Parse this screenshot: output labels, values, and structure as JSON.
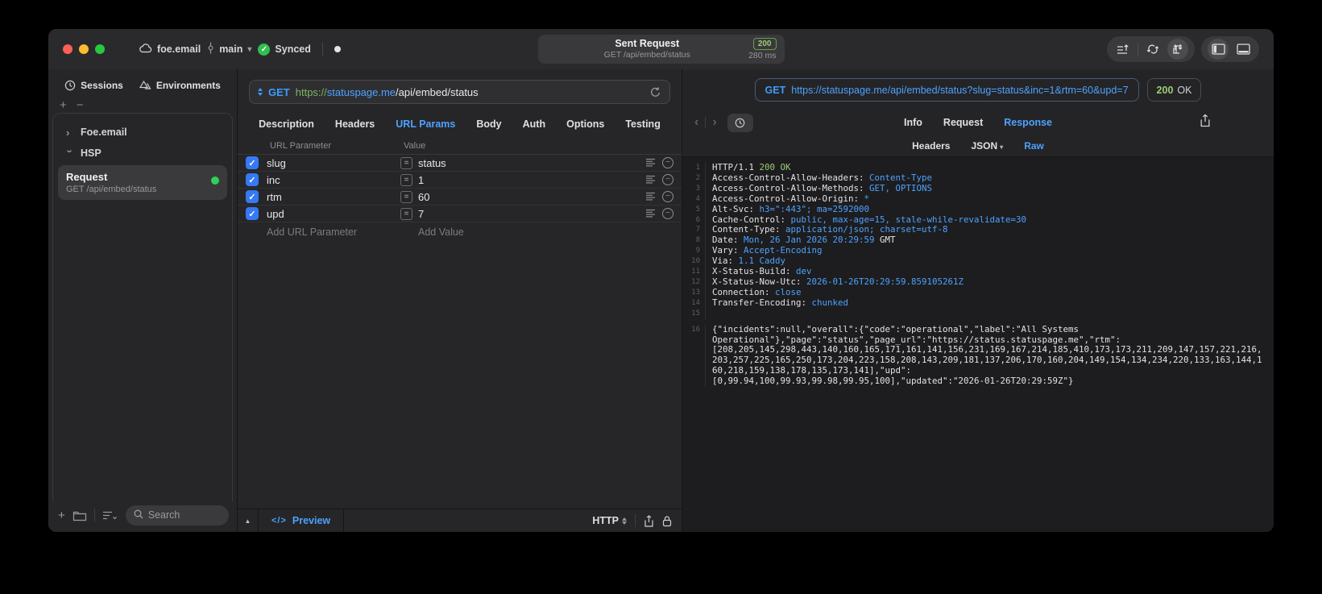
{
  "colors": {
    "accent_blue": "#4da2ff",
    "method_blue": "#3e9bff",
    "status_green": "#9bcc72",
    "scheme_green": "#79b65f",
    "checkbox_blue": "#3579f6",
    "green_dot": "#30d158",
    "traffic_red": "#ff5f57",
    "traffic_yellow": "#febc2e",
    "traffic_green": "#28c840"
  },
  "titlebar": {
    "project": "foe.email",
    "branch": "main",
    "sync_status": "Synced",
    "request_title": "Sent Request",
    "request_subtitle": "GET /api/embed/status",
    "status_code": "200",
    "duration": "280 ms"
  },
  "sidebar": {
    "tabs": [
      {
        "label": "Sessions"
      },
      {
        "label": "Environments"
      }
    ],
    "tree": [
      {
        "label": "Foe.email"
      },
      {
        "label": "HSP"
      }
    ],
    "request_item": {
      "title": "Request",
      "subtitle": "GET /api/embed/status"
    },
    "search_placeholder": "Search"
  },
  "request_panel": {
    "method": "GET",
    "url_scheme": "https://",
    "url_host": "statuspage.me",
    "url_path": "/api/embed/status",
    "tabs": [
      "Description",
      "Headers",
      "URL Params",
      "Body",
      "Auth",
      "Options",
      "Testing"
    ],
    "active_tab": "URL Params",
    "table": {
      "col_param": "URL Parameter",
      "col_value": "Value",
      "rows": [
        {
          "name": "slug",
          "value": "status",
          "enabled": true
        },
        {
          "name": "inc",
          "value": "1",
          "enabled": true
        },
        {
          "name": "rtm",
          "value": "60",
          "enabled": true
        },
        {
          "name": "upd",
          "value": "7",
          "enabled": true
        }
      ],
      "add_param_placeholder": "Add URL Parameter",
      "add_value_placeholder": "Add Value"
    },
    "footer": {
      "preview": "Preview",
      "code_icon": "</>",
      "protocol": "HTTP"
    }
  },
  "response_panel": {
    "method": "GET",
    "url": "https://statuspage.me/api/embed/status?slug=status&inc=1&rtm=60&upd=7",
    "status_code": "200",
    "status_text": "OK",
    "tabs": [
      "Info",
      "Request",
      "Response"
    ],
    "active_tab": "Response",
    "subtabs": [
      "Headers",
      "JSON",
      "Raw"
    ],
    "active_subtab": "Raw",
    "body_lines": [
      {
        "n": "1",
        "segs": [
          [
            "HTTP/1.1 ",
            "w"
          ],
          [
            "200 OK",
            "g"
          ]
        ]
      },
      {
        "n": "2",
        "segs": [
          [
            "Access-Control-Allow-Headers: ",
            "w"
          ],
          [
            "Content-Type",
            "b"
          ]
        ]
      },
      {
        "n": "3",
        "segs": [
          [
            "Access-Control-Allow-Methods: ",
            "w"
          ],
          [
            "GET, OPTIONS",
            "b"
          ]
        ]
      },
      {
        "n": "4",
        "segs": [
          [
            "Access-Control-Allow-Origin: ",
            "w"
          ],
          [
            "*",
            "b"
          ]
        ]
      },
      {
        "n": "5",
        "segs": [
          [
            "Alt-Svc: ",
            "w"
          ],
          [
            "h3=\":443\"; ma=2592000",
            "b"
          ]
        ]
      },
      {
        "n": "6",
        "segs": [
          [
            "Cache-Control: ",
            "w"
          ],
          [
            "public, max-age=15, stale-while-revalidate=30",
            "b"
          ]
        ]
      },
      {
        "n": "7",
        "segs": [
          [
            "Content-Type: ",
            "w"
          ],
          [
            "application/json; charset=utf-8",
            "b"
          ]
        ]
      },
      {
        "n": "8",
        "segs": [
          [
            "Date: ",
            "w"
          ],
          [
            "Mon, 26 Jan 2026 20:29:59",
            "b"
          ],
          [
            " GMT",
            "w"
          ]
        ]
      },
      {
        "n": "9",
        "segs": [
          [
            "Vary: ",
            "w"
          ],
          [
            "Accept-Encoding",
            "b"
          ]
        ]
      },
      {
        "n": "10",
        "segs": [
          [
            "Via: ",
            "w"
          ],
          [
            "1.1 Caddy",
            "b"
          ]
        ]
      },
      {
        "n": "11",
        "segs": [
          [
            "X-Status-Build: ",
            "w"
          ],
          [
            "dev",
            "b"
          ]
        ]
      },
      {
        "n": "12",
        "segs": [
          [
            "X-Status-Now-Utc: ",
            "w"
          ],
          [
            "2026-01-26T20:29:59.859105261Z",
            "b"
          ]
        ]
      },
      {
        "n": "13",
        "segs": [
          [
            "Connection: ",
            "w"
          ],
          [
            "close",
            "b"
          ]
        ]
      },
      {
        "n": "14",
        "segs": [
          [
            "Transfer-Encoding: ",
            "w"
          ],
          [
            "chunked",
            "b"
          ]
        ]
      },
      {
        "n": "15",
        "segs": []
      },
      {
        "n": "16",
        "gap": true,
        "segs": [
          [
            "{\"incidents\":null,\"overall\":{\"code\":\"operational\",\"label\":\"All Systems",
            "w"
          ]
        ]
      },
      {
        "n": "",
        "segs": [
          [
            "Operational\"},\"page\":\"status\",\"page_url\":\"https://status.statuspage.me\",\"rtm\":",
            "w"
          ]
        ]
      },
      {
        "n": "",
        "segs": [
          [
            "[208,205,145,298,443,140,160,165,171,161,141,156,231,169,167,214,185,410,173,173,211,209,147,157,221,216,",
            "w"
          ]
        ]
      },
      {
        "n": "",
        "segs": [
          [
            "203,257,225,165,250,173,204,223,158,208,143,209,181,137,206,170,160,204,149,154,134,234,220,133,163,144,1",
            "w"
          ]
        ]
      },
      {
        "n": "",
        "segs": [
          [
            "60,218,159,138,178,135,173,141],\"upd\":",
            "w"
          ]
        ]
      },
      {
        "n": "",
        "segs": [
          [
            "[0,99.94,100,99.93,99.98,99.95,100],\"updated\":\"2026-01-26T20:29:59Z\"}",
            "w"
          ]
        ]
      }
    ]
  }
}
